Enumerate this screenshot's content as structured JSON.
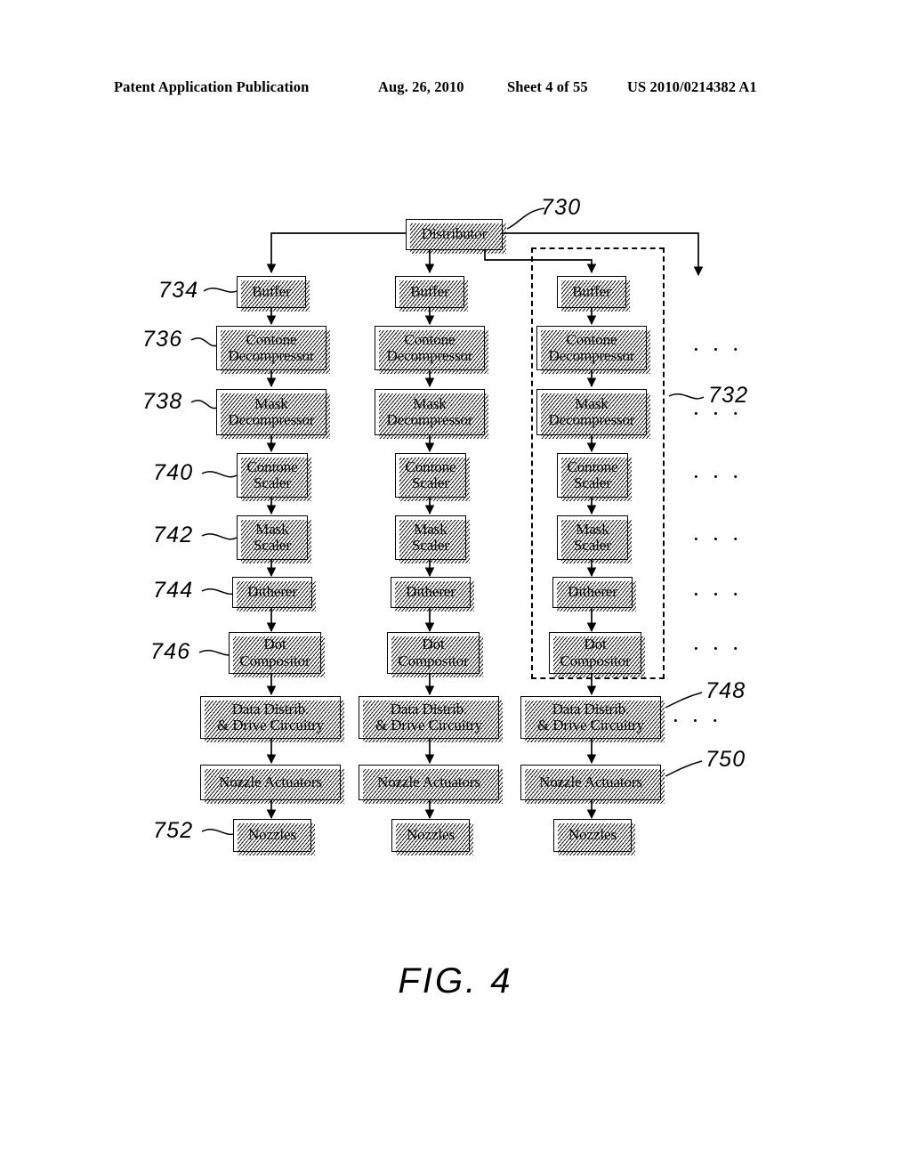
{
  "header": {
    "publication": "Patent Application Publication",
    "date": "Aug. 26, 2010",
    "sheet": "Sheet 4 of 55",
    "patent_number": "US 2010/0214382 A1"
  },
  "figure": {
    "caption": "FIG. 4",
    "distributor": {
      "label": "Distributor",
      "ref": "730"
    },
    "group_ref": "732",
    "ellipsis": "· · ·",
    "stage_refs": {
      "buffer": "734",
      "contone_decompressor": "736",
      "mask_decompressor": "738",
      "contone_scaler": "740",
      "mask_scaler": "742",
      "ditherer": "744",
      "dot_compositor": "746",
      "data_distrib": "748",
      "nozzle_actuators": "750",
      "nozzles": "752"
    },
    "stages": [
      {
        "id": "buffer",
        "label": "Buffer"
      },
      {
        "id": "contone_decompressor",
        "line1": "Contone",
        "line2": "Decompressor"
      },
      {
        "id": "mask_decompressor",
        "line1": "Mask",
        "line2": "Decompressor"
      },
      {
        "id": "contone_scaler",
        "line1": "Contone",
        "line2": "Scaler"
      },
      {
        "id": "mask_scaler",
        "line1": "Mask",
        "line2": "Scaler"
      },
      {
        "id": "ditherer",
        "label": "Ditherer"
      },
      {
        "id": "dot_compositor",
        "line1": "Dot",
        "line2": "Compositor"
      },
      {
        "id": "data_distrib",
        "line1": "Data Distrib.",
        "line2": "& Drive Circuitry"
      },
      {
        "id": "nozzle_actuators",
        "label": "Nozzle Actuators"
      },
      {
        "id": "nozzles",
        "label": "Nozzles"
      }
    ],
    "columns": [
      {
        "index": 0,
        "stages": [
          "Buffer",
          "Contone Decompressor",
          "Mask Decompressor",
          "Contone Scaler",
          "Mask Scaler",
          "Ditherer",
          "Dot Compositor",
          "Data Distrib. & Drive Circuitry",
          "Nozzle Actuators",
          "Nozzles"
        ]
      },
      {
        "index": 1,
        "stages": [
          "Buffer",
          "Contone Decompressor",
          "Mask Decompressor",
          "Contone Scaler",
          "Mask Scaler",
          "Ditherer",
          "Dot Compositor",
          "Data Distrib. & Drive Circuitry",
          "Nozzle Actuators",
          "Nozzles"
        ]
      },
      {
        "index": 2,
        "stages": [
          "Buffer",
          "Contone Decompressor",
          "Mask Decompressor",
          "Contone Scaler",
          "Mask Scaler",
          "Ditherer",
          "Dot Compositor",
          "Data Distrib. & Drive Circuitry",
          "Nozzle Actuators",
          "Nozzles"
        ]
      }
    ],
    "colors": {
      "line": "#000000",
      "background": "#ffffff"
    }
  }
}
